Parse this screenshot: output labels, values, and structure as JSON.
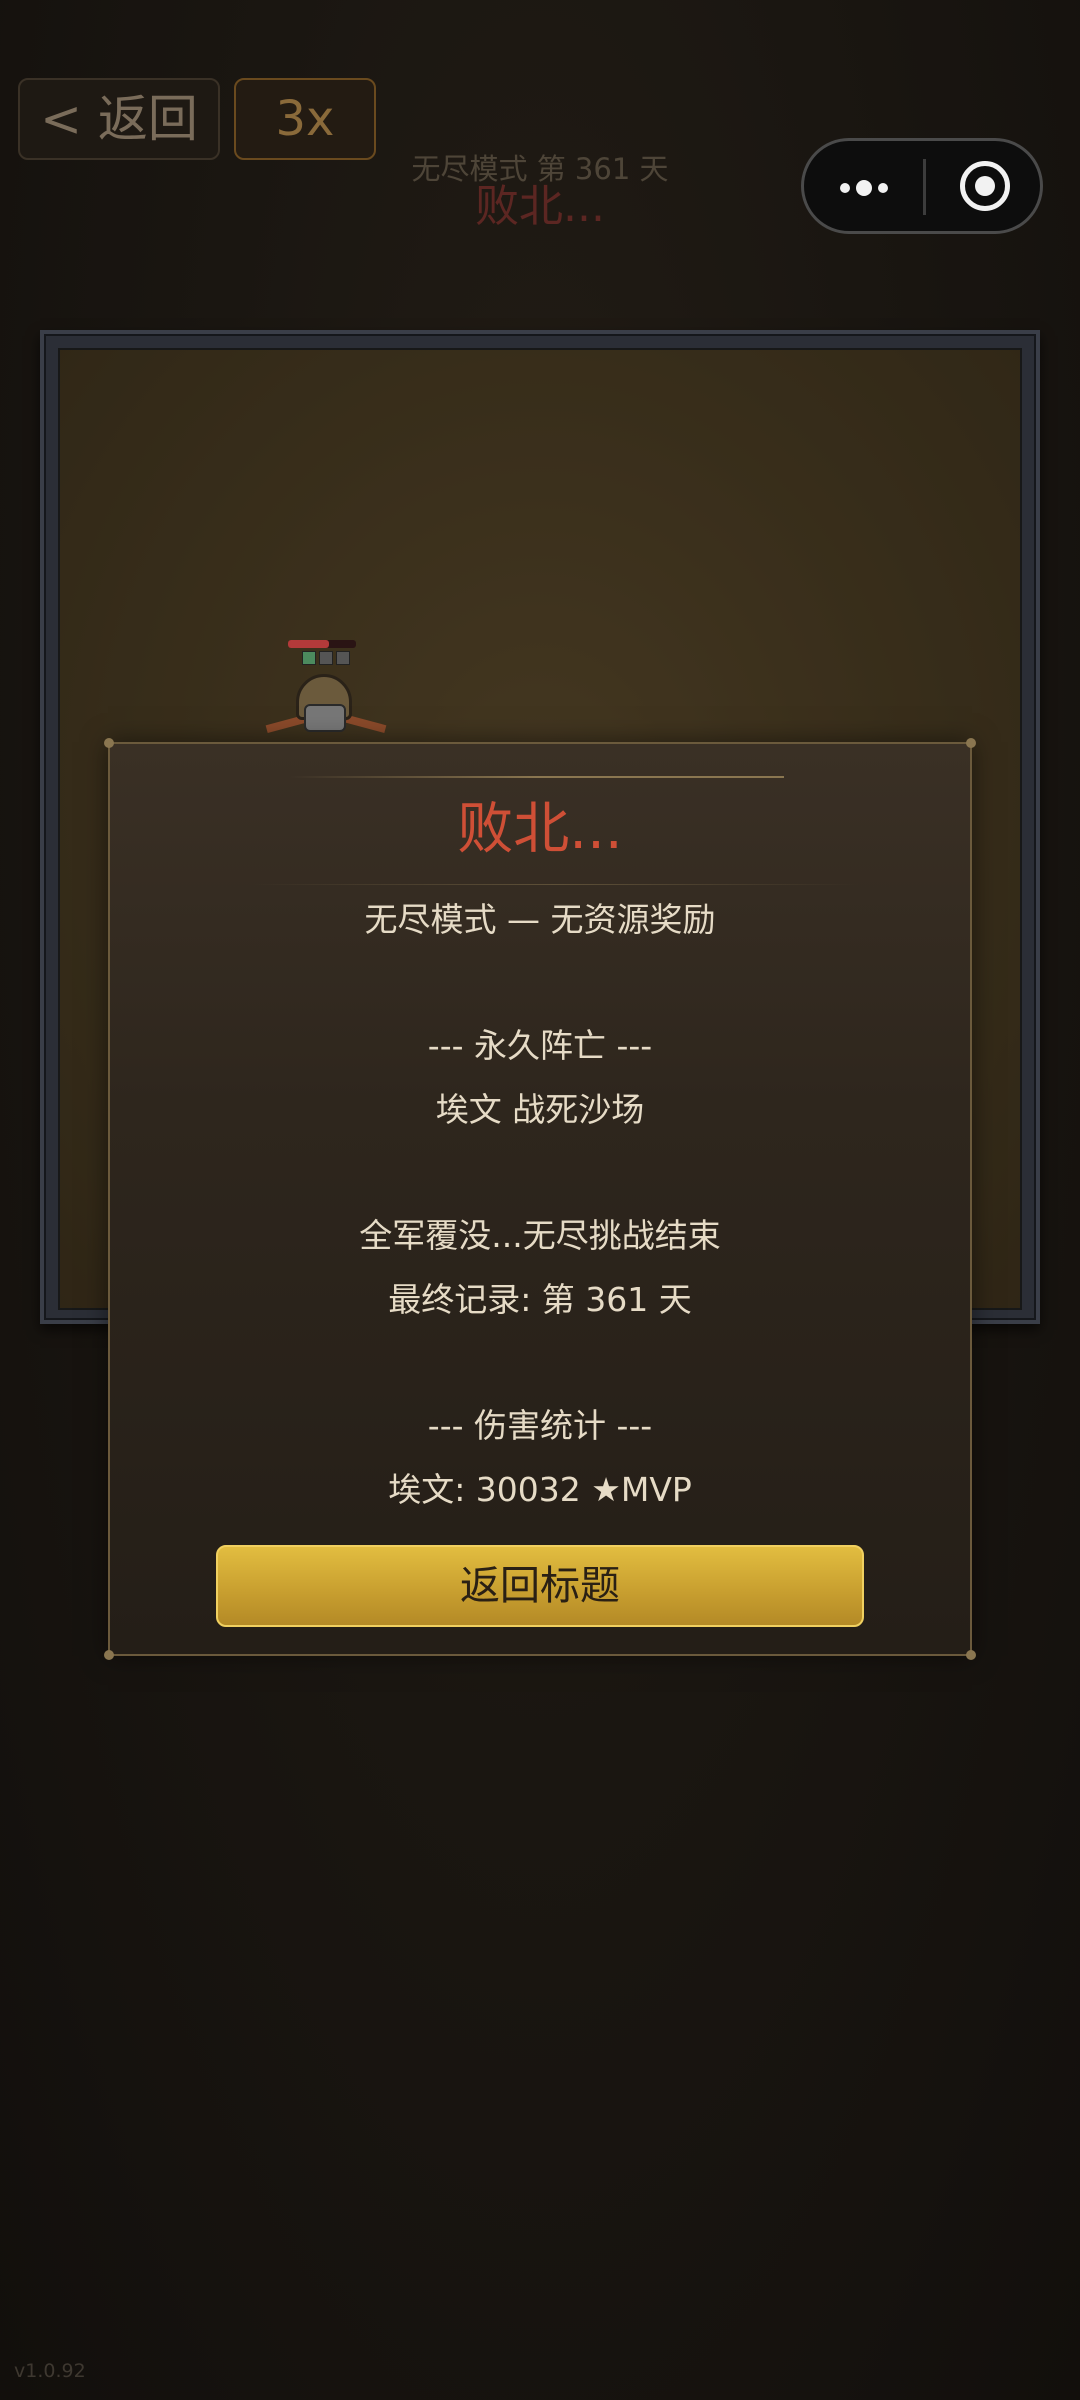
{
  "top_bar": {
    "back_label": "< 返回",
    "speed_label": "3x",
    "mode_text": "无尽模式  第 361 天",
    "status_text": "败北..."
  },
  "unit": {
    "hp_fraction": 0.6,
    "slots_active": 1,
    "slots_total": 3
  },
  "panel": {
    "title": "败北...",
    "lines": [
      "无尽模式 — 无资源奖励",
      "",
      "--- 永久阵亡 ---",
      "埃文 战死沙场",
      "",
      "全军覆没...无尽挑战结束",
      "最终记录: 第 361 天",
      "",
      "--- 伤害统计 ---",
      "埃文: 30032 ★MVP"
    ],
    "button_label": "返回标题"
  },
  "version": "v1.0.92",
  "colors": {
    "title_red": "#cf4f36",
    "button_gold": "#c9a030",
    "panel_text": "#e6dbc6"
  }
}
